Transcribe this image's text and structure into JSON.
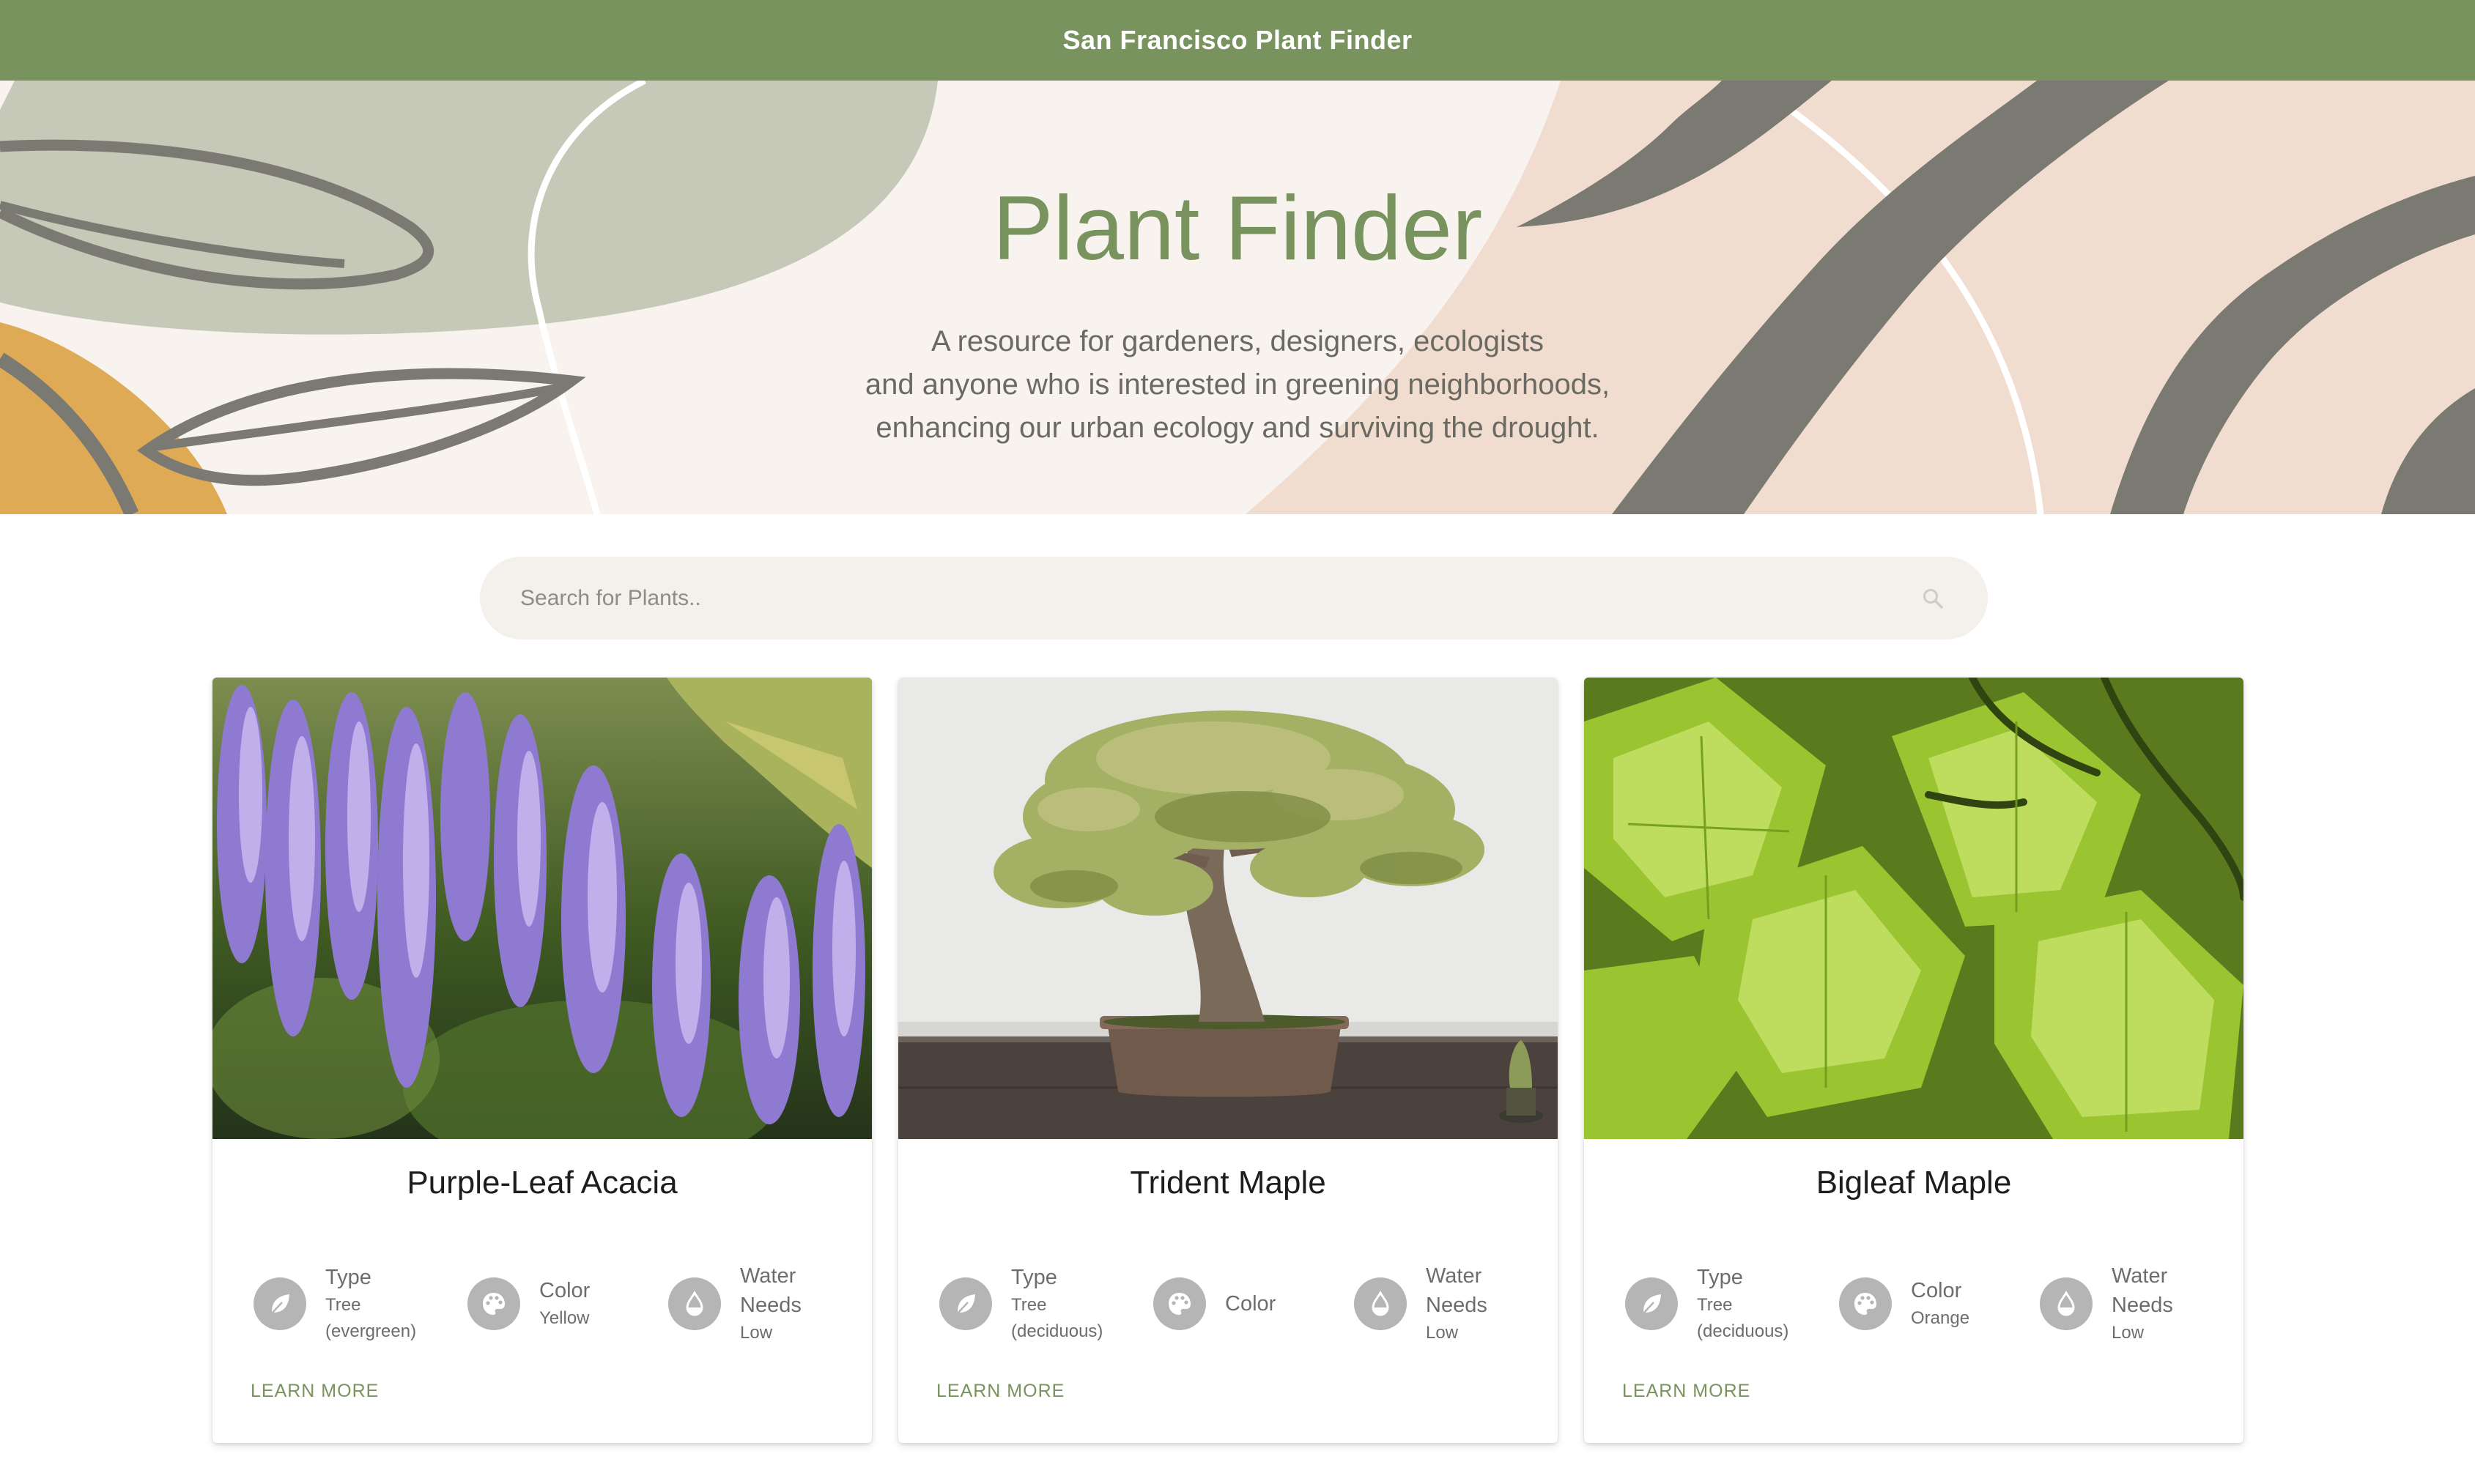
{
  "header": {
    "title": "San Francisco Plant Finder",
    "background_color": "#78935d"
  },
  "hero": {
    "title": "Plant Finder",
    "description_lines": [
      "A resource for gardeners, designers, ecologists",
      "and anyone who is interested in greening neighborhoods,",
      "enhancing our urban ecology and surviving the drought."
    ]
  },
  "search": {
    "placeholder": "Search for Plants..",
    "value": "",
    "icon": "search-icon"
  },
  "cards": [
    {
      "name": "Purple-Leaf Acacia",
      "image": "wisteria-purple-flowers-photo",
      "type_label": "Type",
      "type_value": "Tree (evergreen)",
      "color_label": "Color",
      "color_value": "Yellow",
      "water_label": "Water Needs",
      "water_value": "Low",
      "learn_more": "LEARN MORE"
    },
    {
      "name": "Trident Maple",
      "image": "bonsai-tree-photo",
      "type_label": "Type",
      "type_value": "Tree (deciduous)",
      "color_label": "Color",
      "color_value": "",
      "water_label": "Water Needs",
      "water_value": "Low",
      "learn_more": "LEARN MORE"
    },
    {
      "name": "Bigleaf Maple",
      "image": "green-maple-leaves-photo",
      "type_label": "Type",
      "type_value": "Tree (deciduous)",
      "color_label": "Color",
      "color_value": "Orange",
      "water_label": "Water Needs",
      "water_value": "Low",
      "learn_more": "LEARN MORE"
    }
  ],
  "icons": {
    "type": "leaf-icon",
    "color": "palette-icon",
    "water": "water-drop-icon"
  },
  "colors": {
    "accent": "#78935d",
    "hero_background": "#f8f3ee",
    "icon_circle": "#b5b5b5"
  }
}
